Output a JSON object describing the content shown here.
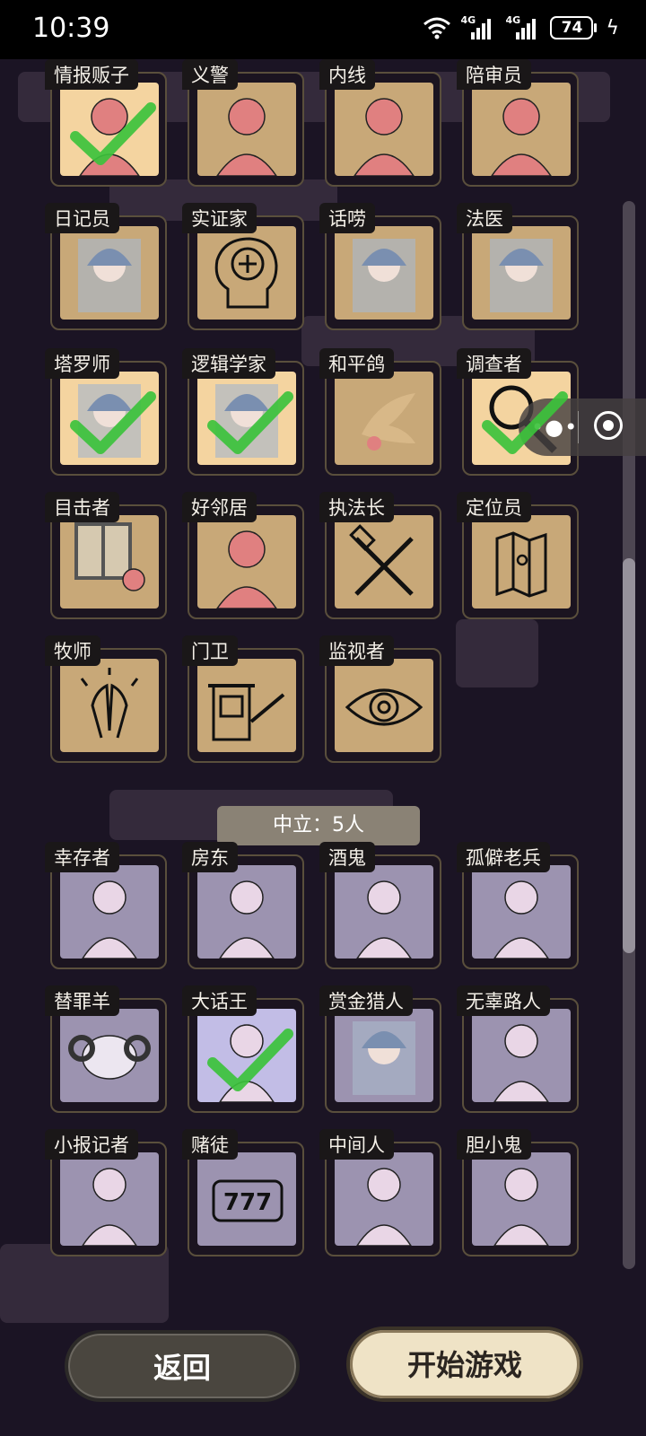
{
  "status_bar": {
    "time": "10:39",
    "battery": "74",
    "network": "4G"
  },
  "good_roles": [
    {
      "label": "情报贩子",
      "selected": true
    },
    {
      "label": "义警",
      "selected": false
    },
    {
      "label": "内线",
      "selected": false
    },
    {
      "label": "陪审员",
      "selected": false
    },
    {
      "label": "日记员",
      "selected": false
    },
    {
      "label": "实证家",
      "selected": false
    },
    {
      "label": "话唠",
      "selected": false
    },
    {
      "label": "法医",
      "selected": false
    },
    {
      "label": "塔罗师",
      "selected": true
    },
    {
      "label": "逻辑学家",
      "selected": true
    },
    {
      "label": "和平鸽",
      "selected": false
    },
    {
      "label": "调查者",
      "selected": true
    },
    {
      "label": "目击者",
      "selected": false
    },
    {
      "label": "好邻居",
      "selected": false
    },
    {
      "label": "执法长",
      "selected": false
    },
    {
      "label": "定位员",
      "selected": false
    },
    {
      "label": "牧师",
      "selected": false
    },
    {
      "label": "门卫",
      "selected": false
    },
    {
      "label": "监视者",
      "selected": false
    }
  ],
  "neutral_header": "中立：5人",
  "neutral_roles": [
    {
      "label": "幸存者",
      "selected": false
    },
    {
      "label": "房东",
      "selected": false
    },
    {
      "label": "酒鬼",
      "selected": false
    },
    {
      "label": "孤僻老兵",
      "selected": false
    },
    {
      "label": "替罪羊",
      "selected": false
    },
    {
      "label": "大话王",
      "selected": true
    },
    {
      "label": "赏金猎人",
      "selected": false
    },
    {
      "label": "无辜路人",
      "selected": false
    },
    {
      "label": "小报记者",
      "selected": false
    },
    {
      "label": "赌徒",
      "selected": false
    },
    {
      "label": "中间人",
      "selected": false
    },
    {
      "label": "胆小鬼",
      "selected": false
    }
  ],
  "buttons": {
    "back": "返回",
    "start": "开始游戏"
  },
  "colors": {
    "good_card": "#c8a878",
    "neutral_card": "#9c93b0",
    "check": "#3cc23c"
  }
}
